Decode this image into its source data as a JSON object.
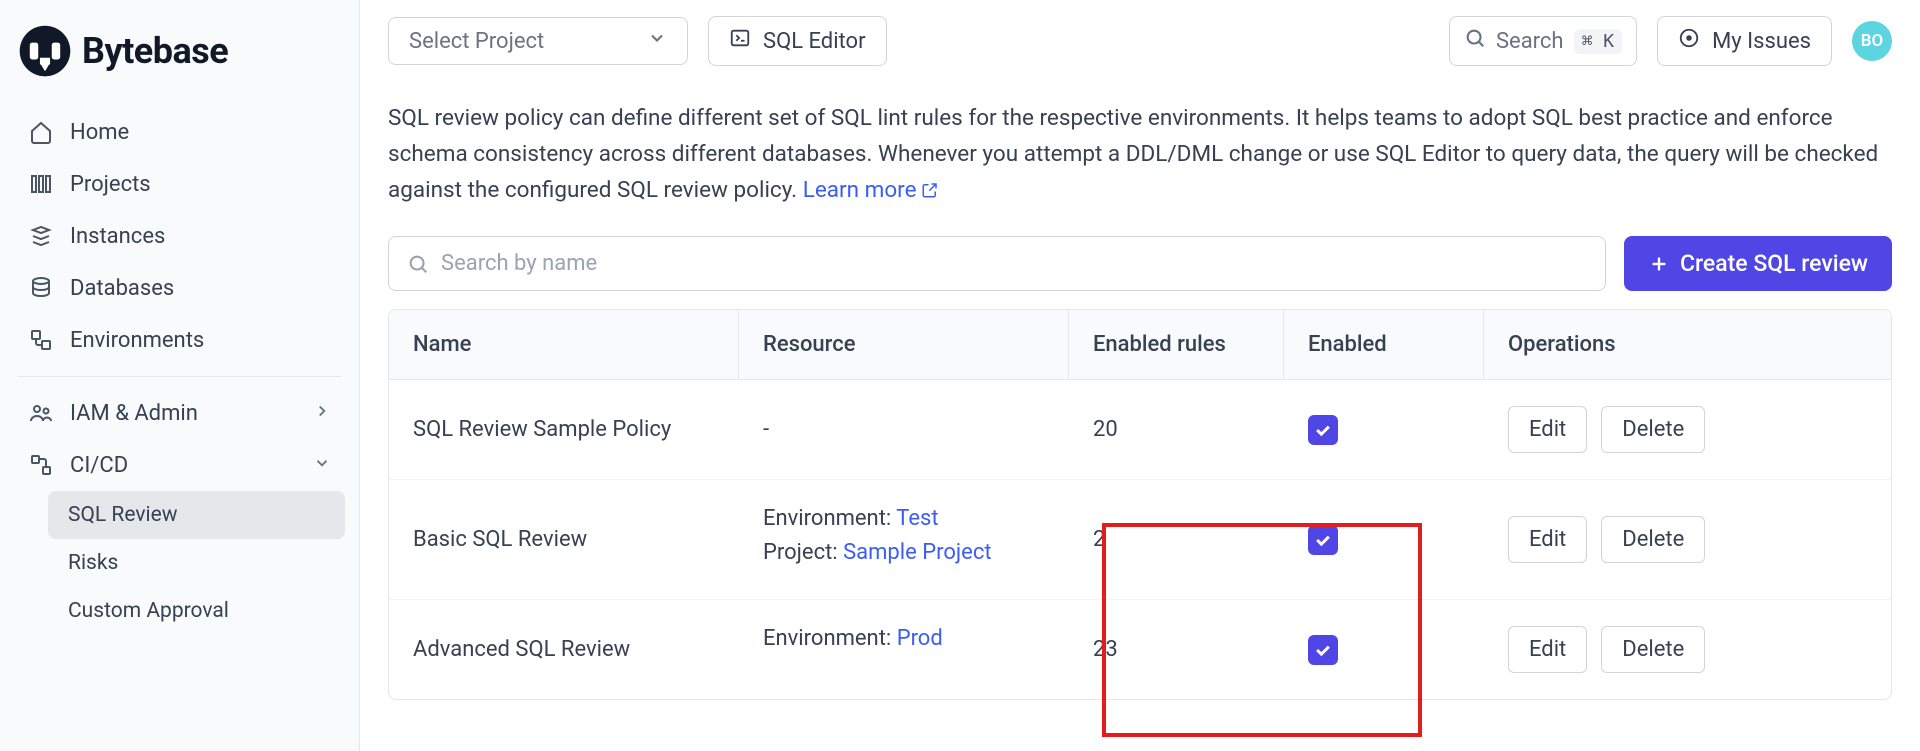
{
  "brand": {
    "name": "Bytebase"
  },
  "sidebar": {
    "items": [
      {
        "label": "Home"
      },
      {
        "label": "Projects"
      },
      {
        "label": "Instances"
      },
      {
        "label": "Databases"
      },
      {
        "label": "Environments"
      }
    ],
    "admin_items": [
      {
        "label": "IAM & Admin"
      },
      {
        "label": "CI/CD"
      }
    ],
    "cicd_sub": [
      {
        "label": "SQL Review"
      },
      {
        "label": "Risks"
      },
      {
        "label": "Custom Approval"
      }
    ]
  },
  "topbar": {
    "select_project": "Select Project",
    "sql_editor": "SQL Editor",
    "search_placeholder": "Search",
    "search_kbd": "⌘ K",
    "my_issues": "My Issues",
    "avatar": "BO"
  },
  "page": {
    "description": "SQL review policy can define different set of SQL lint rules for the respective environments. It helps teams to adopt SQL best practice and enforce schema consistency across different databases. Whenever you attempt a DDL/DML change or use SQL Editor to query data, the query will be checked against the configured SQL review policy. ",
    "learn_more": "Learn more",
    "search_by_name_placeholder": "Search by name",
    "create_button": "Create SQL review"
  },
  "table": {
    "headers": {
      "name": "Name",
      "resource": "Resource",
      "enabled_rules": "Enabled rules",
      "enabled": "Enabled",
      "operations": "Operations"
    },
    "rows": [
      {
        "name": "SQL Review Sample Policy",
        "resource_text": "-",
        "enabled_rules": "20",
        "enabled": true
      },
      {
        "name": "Basic SQL Review",
        "env_prefix": "Environment: ",
        "env_link": "Test",
        "proj_prefix": "Project: ",
        "proj_link": "Sample Project",
        "enabled_rules": "2",
        "enabled": true
      },
      {
        "name": "Advanced SQL Review",
        "env_prefix": "Environment: ",
        "env_link": "Prod",
        "enabled_rules": "23",
        "enabled": true
      }
    ],
    "edit_label": "Edit",
    "delete_label": "Delete"
  }
}
